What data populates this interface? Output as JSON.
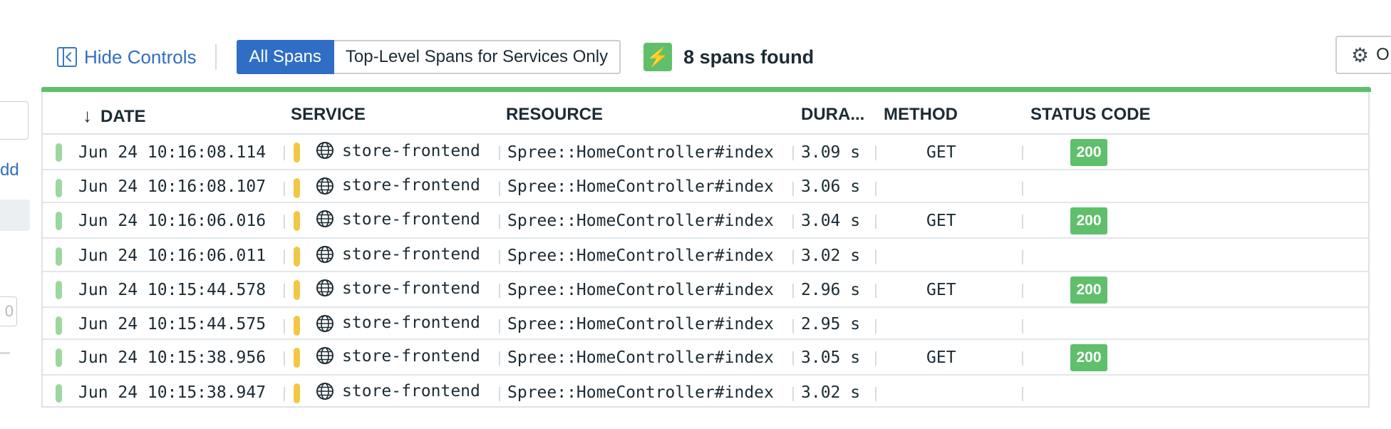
{
  "left_panel": {
    "link_text": "dd",
    "number_text": "0"
  },
  "toolbar": {
    "hide_controls_label": "Hide Controls",
    "segments": [
      "All Spans",
      "Top-Level Spans for Services Only"
    ],
    "active_segment": "All Spans",
    "found_text": "8 spans found",
    "options_label": "O"
  },
  "table": {
    "headers": {
      "date": "DATE",
      "service": "SERVICE",
      "resource": "RESOURCE",
      "duration": "DURA...",
      "method": "METHOD",
      "status_code": "STATUS CODE"
    },
    "rows": [
      {
        "date": "Jun 24 10:16:08.114",
        "service": "store-frontend",
        "resource": "Spree::HomeController#index",
        "duration": "3.09 s",
        "method": "GET",
        "status": "200"
      },
      {
        "date": "Jun 24 10:16:08.107",
        "service": "store-frontend",
        "resource": "Spree::HomeController#index",
        "duration": "3.06 s",
        "method": "",
        "status": ""
      },
      {
        "date": "Jun 24 10:16:06.016",
        "service": "store-frontend",
        "resource": "Spree::HomeController#index",
        "duration": "3.04 s",
        "method": "GET",
        "status": "200"
      },
      {
        "date": "Jun 24 10:16:06.011",
        "service": "store-frontend",
        "resource": "Spree::HomeController#index",
        "duration": "3.02 s",
        "method": "",
        "status": ""
      },
      {
        "date": "Jun 24 10:15:44.578",
        "service": "store-frontend",
        "resource": "Spree::HomeController#index",
        "duration": "2.96 s",
        "method": "GET",
        "status": "200"
      },
      {
        "date": "Jun 24 10:15:44.575",
        "service": "store-frontend",
        "resource": "Spree::HomeController#index",
        "duration": "2.95 s",
        "method": "",
        "status": ""
      },
      {
        "date": "Jun 24 10:15:38.956",
        "service": "store-frontend",
        "resource": "Spree::HomeController#index",
        "duration": "3.05 s",
        "method": "GET",
        "status": "200"
      },
      {
        "date": "Jun 24 10:15:38.947",
        "service": "store-frontend",
        "resource": "Spree::HomeController#index",
        "duration": "3.02 s",
        "method": "",
        "status": ""
      }
    ]
  },
  "colors": {
    "accent": "#2f6ec4",
    "success": "#5fbf6b",
    "service": "#f2c744"
  }
}
